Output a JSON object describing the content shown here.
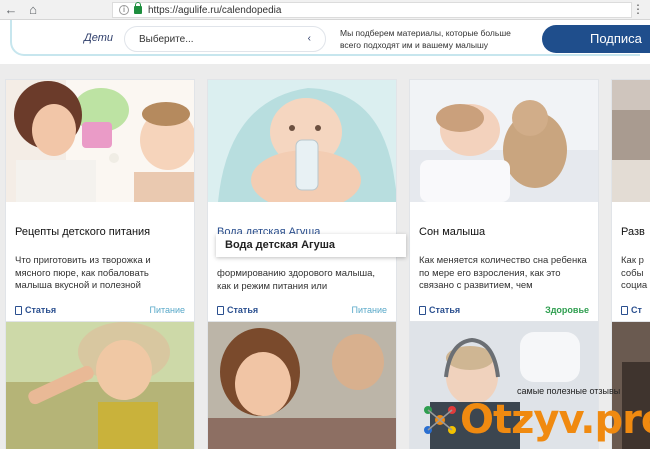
{
  "browser": {
    "url": "https://agulife.ru/calendopedia"
  },
  "header": {
    "section_label": "Дети",
    "select_placeholder": "Выберите...",
    "promo_text": "Мы подберем материалы, которые больше всего подходят им и вашему малышу",
    "subscribe_label": "Подписа"
  },
  "cards": [
    {
      "title": "Рецепты детского питания",
      "desc": "Что приготовить из творожка и мясного пюре, как побаловать малыша вкусной и полезной",
      "type": "Статья",
      "category": "Питание",
      "category_color": "#5aa9c9"
    },
    {
      "title": "Вода детская Агуша",
      "desc": "формированию здорового малыша, как и режим питания или",
      "type": "Статья",
      "category": "Питание",
      "category_color": "#5aa9c9"
    },
    {
      "title": "Сон малыша",
      "desc": "Как меняется количество сна ребенка по мере его взросления, как это связано с развитием, чем",
      "type": "Статья",
      "category": "Здоровье",
      "category_color": "#2e9e4f"
    },
    {
      "title": "Разв",
      "desc": "Как р собы социа",
      "type": "Ст",
      "category": "",
      "category_color": "#5aa9c9"
    }
  ],
  "tooltip": "Вода детская Агуша",
  "watermark": {
    "tagline": "самые полезные отзывы",
    "logo": "Otzyv.pro"
  }
}
